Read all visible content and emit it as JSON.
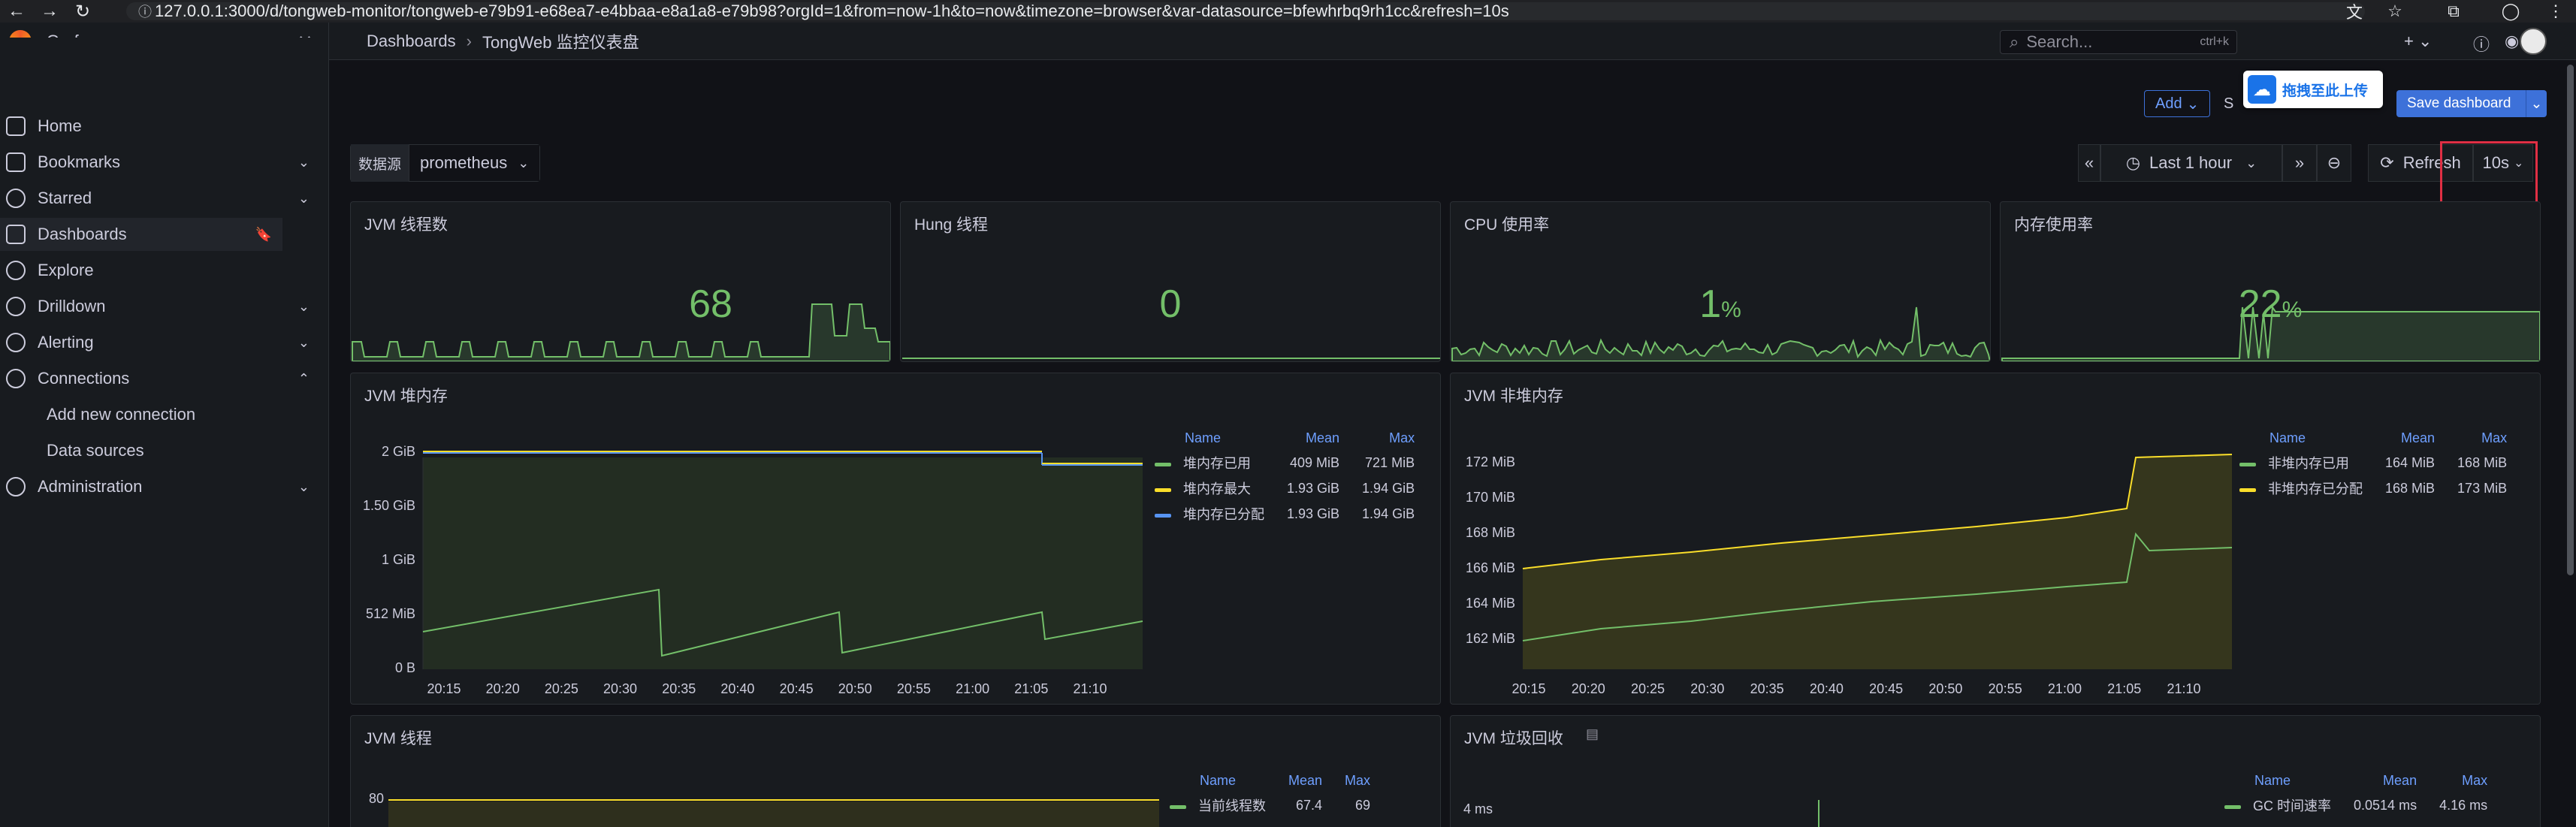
{
  "browser": {
    "url": "127.0.0.1:3000/d/tongweb-monitor/tongweb-e79b91-e68ea7-e4bbaa-e8a1a8-e79b98?orgId=1&from=now-1h&to=now&timezone=browser&var-datasource=bfewhrbq9rh1cc&refresh=10s"
  },
  "app": {
    "name": "Grafana"
  },
  "sidebar": {
    "items": [
      {
        "label": "Home"
      },
      {
        "label": "Bookmarks"
      },
      {
        "label": "Starred"
      },
      {
        "label": "Dashboards"
      },
      {
        "label": "Explore"
      },
      {
        "label": "Drilldown"
      },
      {
        "label": "Alerting"
      },
      {
        "label": "Connections"
      },
      {
        "label": "Add new connection"
      },
      {
        "label": "Data sources"
      },
      {
        "label": "Administration"
      }
    ]
  },
  "breadcrumb": {
    "root": "Dashboards",
    "current": "TongWeb 监控仪表盘"
  },
  "search": {
    "placeholder": "Search...",
    "shortcut": "ctrl+k"
  },
  "toolbar": {
    "add_label": "Add",
    "settings_label": "S",
    "save_label": "Save dashboard",
    "popup_text": "拖拽至此上传"
  },
  "variables": {
    "datasource_label": "数据源",
    "datasource_value": "prometheus"
  },
  "time": {
    "range": "Last 1 hour",
    "refresh_label": "Refresh",
    "refresh_interval": "10s"
  },
  "stats": [
    {
      "title": "JVM 线程数",
      "value": "68",
      "unit": ""
    },
    {
      "title": "Hung 线程",
      "value": "0",
      "unit": ""
    },
    {
      "title": "CPU 使用率",
      "value": "1",
      "unit": "%"
    },
    {
      "title": "内存使用率",
      "value": "22",
      "unit": "%"
    }
  ],
  "panels": {
    "heap": {
      "title": "JVM 堆内存",
      "legend_headers": [
        "Name",
        "Mean",
        "Max"
      ],
      "rows": [
        {
          "name": "堆内存已用",
          "mean": "409 MiB",
          "max": "721 MiB",
          "color": "#73bf69"
        },
        {
          "name": "堆内存最大",
          "mean": "1.93 GiB",
          "max": "1.94 GiB",
          "color": "#fade2a"
        },
        {
          "name": "堆内存已分配",
          "mean": "1.93 GiB",
          "max": "1.94 GiB",
          "color": "#5794f2"
        }
      ],
      "y_ticks": [
        "2 GiB",
        "1.50 GiB",
        "1 GiB",
        "512 MiB",
        "0 B"
      ],
      "x_ticks": [
        "20:15",
        "20:20",
        "20:25",
        "20:30",
        "20:35",
        "20:40",
        "20:45",
        "20:50",
        "20:55",
        "21:00",
        "21:05",
        "21:10"
      ]
    },
    "nonheap": {
      "title": "JVM 非堆内存",
      "legend_headers": [
        "Name",
        "Mean",
        "Max"
      ],
      "rows": [
        {
          "name": "非堆内存已用",
          "mean": "164 MiB",
          "max": "168 MiB",
          "color": "#73bf69"
        },
        {
          "name": "非堆内存已分配",
          "mean": "168 MiB",
          "max": "173 MiB",
          "color": "#fade2a"
        }
      ],
      "y_ticks": [
        "172 MiB",
        "170 MiB",
        "168 MiB",
        "166 MiB",
        "164 MiB",
        "162 MiB"
      ],
      "x_ticks": [
        "20:15",
        "20:20",
        "20:25",
        "20:30",
        "20:35",
        "20:40",
        "20:45",
        "20:50",
        "20:55",
        "21:00",
        "21:05",
        "21:10"
      ]
    },
    "threads": {
      "title": "JVM 线程",
      "legend_headers": [
        "Name",
        "Mean",
        "Max"
      ],
      "rows": [
        {
          "name": "当前线程数",
          "mean": "67.4",
          "max": "69",
          "color": "#73bf69"
        }
      ],
      "y_ticks": [
        "80"
      ]
    },
    "gc": {
      "title": "JVM 垃圾回收",
      "legend_headers": [
        "Name",
        "Mean",
        "Max"
      ],
      "rows": [
        {
          "name": "GC 时间速率",
          "mean": "0.0514 ms",
          "max": "4.16 ms",
          "color": "#73bf69"
        }
      ],
      "y_ticks": [
        "4 ms"
      ]
    }
  },
  "colors": {
    "green": "#73bf69",
    "yellow": "#fade2a",
    "blue": "#5794f2",
    "accent": "#3d71d9"
  }
}
